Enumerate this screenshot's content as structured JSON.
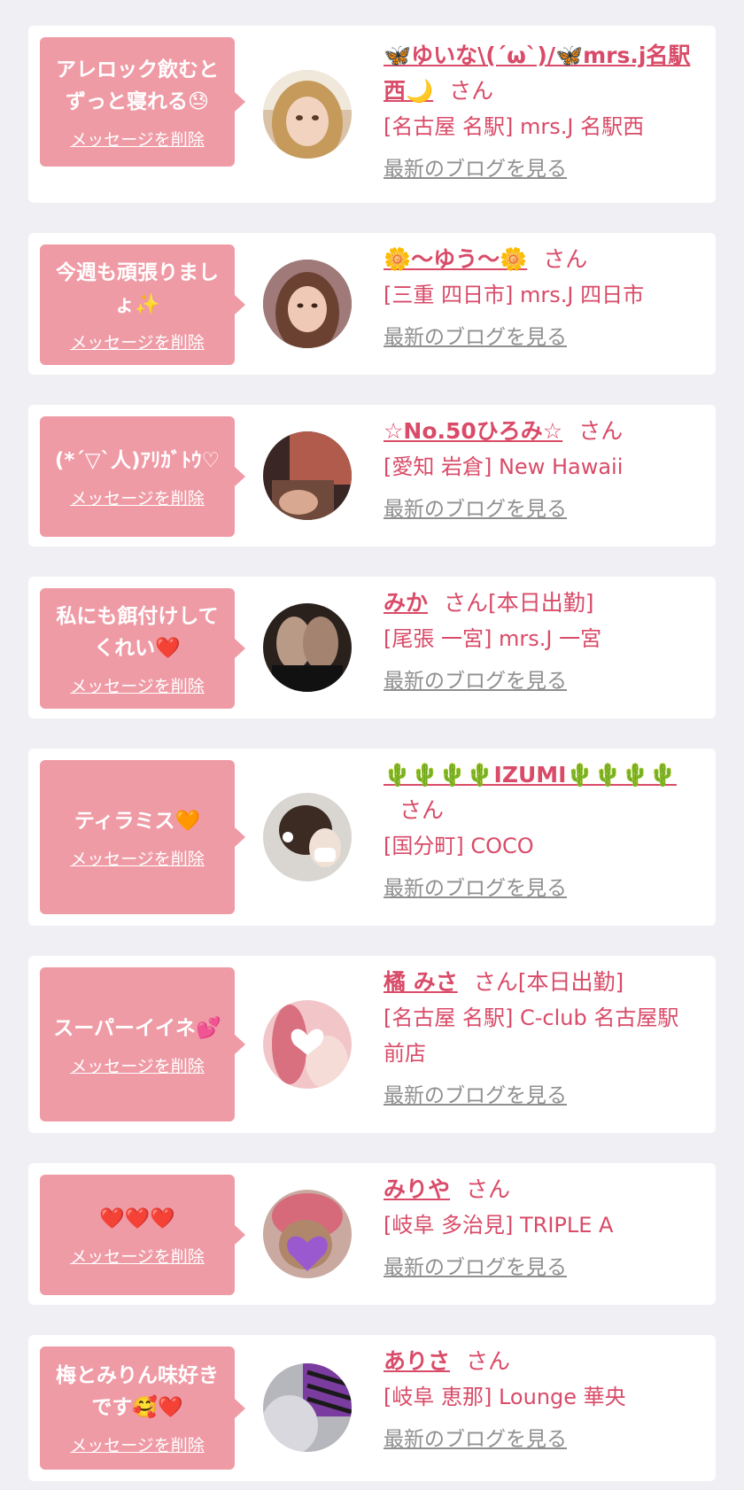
{
  "delete_label": "メッセージを削除",
  "blog_label": "最新のブログを見る",
  "san_label": "さん",
  "cards": [
    {
      "message": "アレロック飲むとずっと寝れる",
      "message_emoji": "😓",
      "name": "🦋ゆいな\\(´ω`)/🦋mrs.j名駅西🌙",
      "suffix": "さん",
      "shop": "[名古屋 名駅] mrs.J 名駅西"
    },
    {
      "message": "今週も頑張りましょ",
      "message_emoji": "✨",
      "name": "🌼〜ゆう〜🌼",
      "suffix": "さん",
      "shop": "[三重 四日市] mrs.J 四日市"
    },
    {
      "message": "(*´▽`人)ｱﾘｶﾞﾄｳ♡",
      "message_emoji": "",
      "name": "☆No.50ひろみ☆",
      "suffix": "さん",
      "shop": "[愛知 岩倉] New Hawaii"
    },
    {
      "message": "私にも餌付けしてくれい",
      "message_emoji": "❤️",
      "name": "みか",
      "suffix": "さん[本日出勤]",
      "shop": "[尾張 一宮] mrs.J 一宮"
    },
    {
      "message": "ティラミス",
      "message_emoji": "🧡",
      "name": "🌵🌵🌵🌵IZUMI🌵🌵🌵🌵",
      "suffix": "さん",
      "shop": "[国分町] COCO"
    },
    {
      "message": "スーパーイイネ",
      "message_emoji": "💕",
      "name": "橘 みさ",
      "suffix": "さん[本日出勤]",
      "shop": "[名古屋 名駅] C-club 名古屋駅前店"
    },
    {
      "message": "",
      "message_emoji": "❤️❤️❤️",
      "name": "みりや",
      "suffix": "さん",
      "shop": "[岐阜 多治見] TRIPLE A"
    },
    {
      "message": "梅とみりん味好きです",
      "message_emoji": "🥰❤️",
      "name": "ありさ",
      "suffix": "さん",
      "shop": "[岐阜 恵那] Lounge 華央"
    }
  ],
  "colors": {
    "background": "#f0eff3",
    "bubble": "#ef9ba6",
    "name": "#d94b68",
    "blog_link": "#8f8f8f"
  }
}
